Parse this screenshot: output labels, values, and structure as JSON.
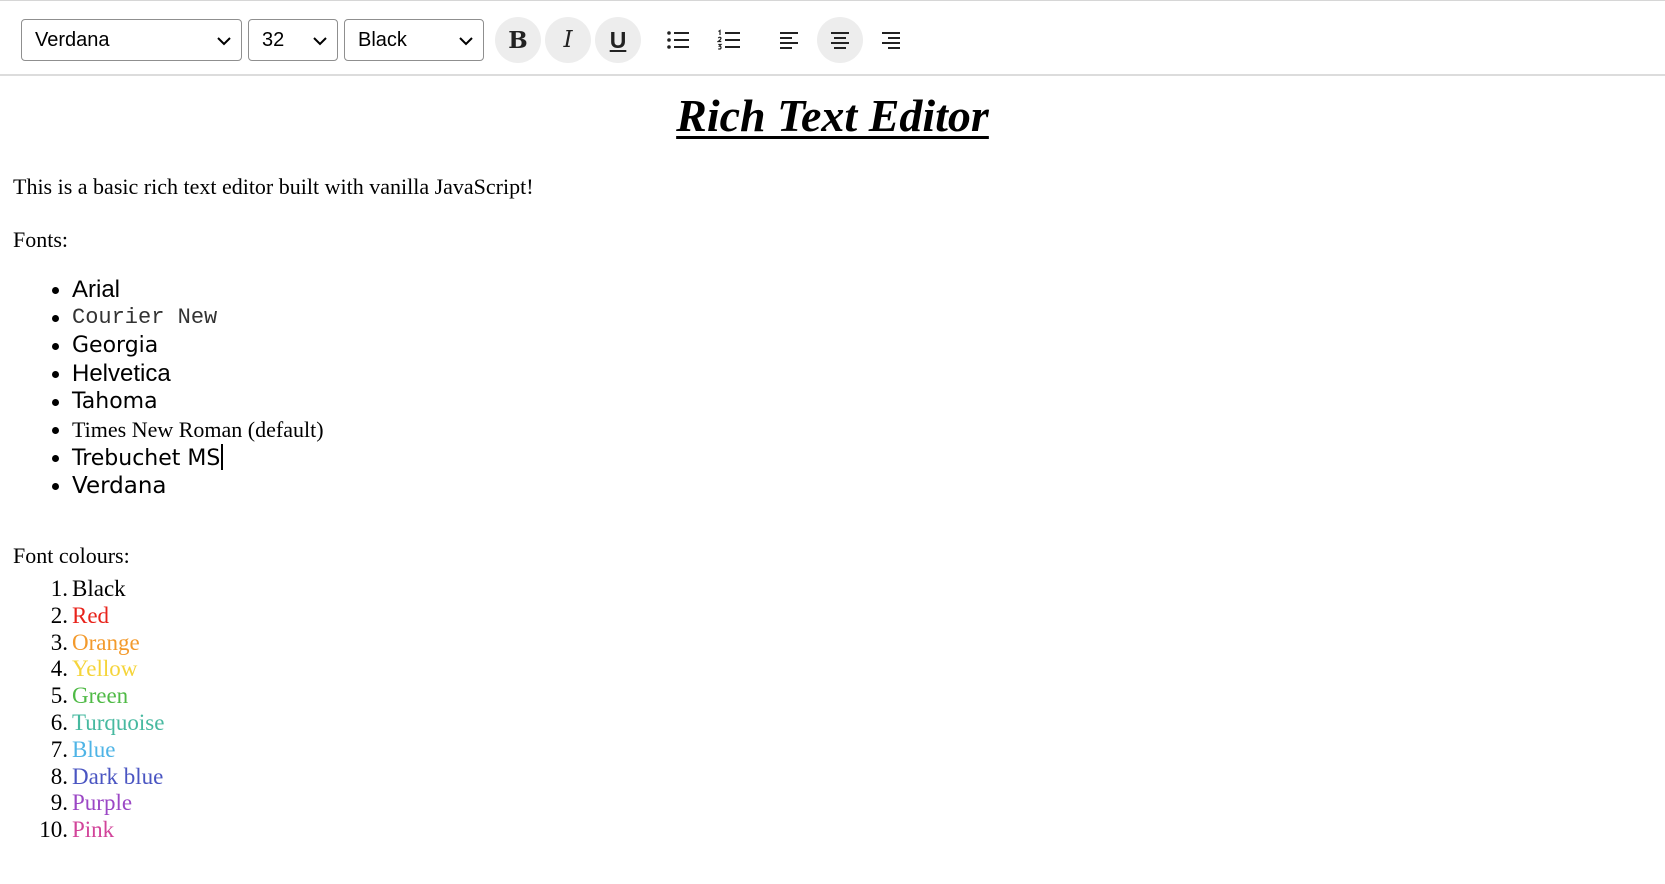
{
  "toolbar": {
    "font_select": "Verdana",
    "size_select": "32",
    "color_select": "Black",
    "bold": "B",
    "italic": "I",
    "underline": "U"
  },
  "editor": {
    "title": "Rich Text Editor",
    "intro": "This is a basic rich text editor built with vanilla JavaScript!",
    "fonts_heading": "Fonts:",
    "fonts": [
      "Arial",
      "Courier New",
      "Georgia",
      "Helvetica",
      "Tahoma",
      "Times New Roman (default)",
      "Trebuchet MS",
      "Verdana"
    ],
    "colours_heading": "Font colours:",
    "colours": [
      {
        "num": "1.",
        "label": "Black",
        "color": "#000000"
      },
      {
        "num": "2.",
        "label": "Red",
        "color": "#e8231b"
      },
      {
        "num": "3.",
        "label": "Orange",
        "color": "#f39a2c"
      },
      {
        "num": "4.",
        "label": "Yellow",
        "color": "#f5d43a"
      },
      {
        "num": "5.",
        "label": "Green",
        "color": "#4fba46"
      },
      {
        "num": "6.",
        "label": "Turquoise",
        "color": "#47b9a0"
      },
      {
        "num": "7.",
        "label": "Blue",
        "color": "#4eb4e6"
      },
      {
        "num": "8.",
        "label": "Dark blue",
        "color": "#4a55c2"
      },
      {
        "num": "9.",
        "label": "Purple",
        "color": "#9b47c5"
      },
      {
        "num": "10.",
        "label": "Pink",
        "color": "#d2449a"
      }
    ]
  }
}
